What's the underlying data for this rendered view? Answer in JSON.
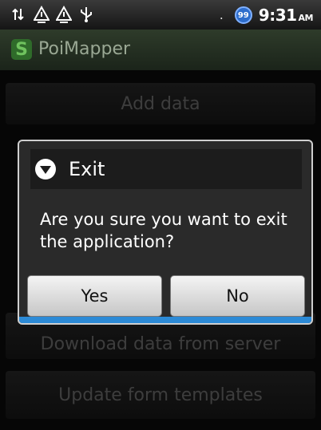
{
  "status_bar": {
    "icons": [
      "data-transfer-icon",
      "signal-warning-icon",
      "signal-warning-icon",
      "usb-icon"
    ],
    "battery_percent": "99",
    "time": "9:31",
    "ampm": "AM"
  },
  "app": {
    "title": "PoiMapper"
  },
  "menu": {
    "add_data": "Add data",
    "download": "Download data from server",
    "update_templates": "Update form templates"
  },
  "dialog": {
    "title": "Exit",
    "message": "Are you sure you want to exit the application?",
    "yes": "Yes",
    "no": "No",
    "accent_color": "#2c8ad6"
  }
}
